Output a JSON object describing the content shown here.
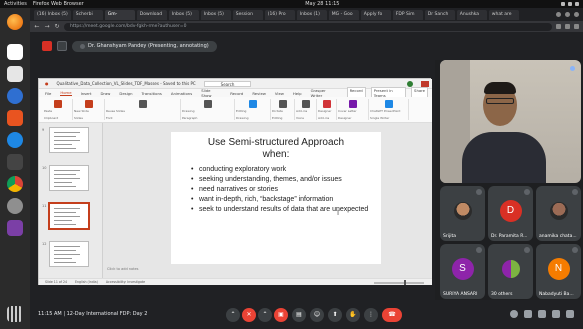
{
  "os": {
    "activities": "Activities",
    "browser_name": "Firefox Web Browser",
    "clock": "May 28 11:15"
  },
  "browser": {
    "tabs": [
      {
        "label": "(16) Inbox (5)"
      },
      {
        "label": "Scherbi"
      },
      {
        "label": "Gm-",
        "active": true
      },
      {
        "label": "Download"
      },
      {
        "label": "Inbox (5)"
      },
      {
        "label": "Inbox (5)"
      },
      {
        "label": "Session"
      },
      {
        "label": "(16) Pro"
      },
      {
        "label": "Inbox (1)"
      },
      {
        "label": "MG - Goo"
      },
      {
        "label": "Apply fo"
      },
      {
        "label": "FDP Sim"
      },
      {
        "label": "Dr Sanch"
      },
      {
        "label": "Anushka"
      },
      {
        "label": "what are"
      }
    ],
    "url": "https://meet.google.com/bdv-fgkh-rme?authuser=0"
  },
  "meet": {
    "presenting_label": "Dr. Ghanshyam Pandey (Presenting, annotating)",
    "meeting_time": "11:15 AM",
    "meeting_name": "12-Day International FDP: Day 2"
  },
  "powerpoint": {
    "file_title": "Qualitative_Data_Collection_VL_Slides_TDF_Masses - Saved to this PC",
    "search_placeholder": "Search",
    "menu": [
      "File",
      "Home",
      "Insert",
      "Draw",
      "Design",
      "Transitions",
      "Animations",
      "Slide Show",
      "Record",
      "Review",
      "View",
      "Help",
      "Grasper Writer"
    ],
    "active_menu": "Home",
    "menu_right": [
      "Record",
      "Present in Teams",
      "Share"
    ],
    "ribbon_groups": [
      "Clipboard",
      "Slides",
      "Font",
      "Paragraph",
      "Drawing",
      "Editing",
      "Voice",
      "Add-ins",
      "Designer",
      "Single Writer"
    ],
    "ribbon_labels": [
      "Paste",
      "New Slide",
      "Reuse Slides",
      "Drawing",
      "Editing",
      "Dictate",
      "Add-ins",
      "Designer",
      "Cover Letter",
      "ChatGPT PowerPoint"
    ],
    "notes_placeholder": "Click to add notes",
    "status": [
      "Slide 11 of 24",
      "English (India)",
      "Accessibility: Investigate"
    ],
    "thumbnails": [
      {
        "num": "9"
      },
      {
        "num": "10"
      },
      {
        "num": "11",
        "selected": true
      },
      {
        "num": "12"
      }
    ]
  },
  "slide": {
    "title_line1": "Use Semi-structured Approach",
    "title_line2": "when:",
    "bullets": [
      "conducting exploratory work",
      "seeking understanding, themes, and/or issues",
      "need narratives or stories",
      "want in-depth, rich, “backstage” information",
      "seek to understand results of data that are unexpected"
    ]
  },
  "participants": [
    {
      "name": "Srijita",
      "type": "photo",
      "color": "#c08a64"
    },
    {
      "name": "Dr. Paramita R...",
      "type": "initial",
      "initial": "D",
      "color": "#d93025"
    },
    {
      "name": "anamika chata...",
      "type": "photo",
      "color": "#9c6b55"
    },
    {
      "name": "SURIYA ANSARI",
      "type": "initial",
      "initial": "S",
      "color": "#8e24aa"
    },
    {
      "name": "30 others",
      "type": "others",
      "color": "#5f6368"
    },
    {
      "name": "Nabadyuti Ba...",
      "type": "initial",
      "initial": "N",
      "color": "#f57c00"
    }
  ],
  "colors": {
    "meet_bg": "#202124",
    "tile_bg": "#3c4043",
    "hangup": "#ea4335",
    "ppt_accent": "#c43e1c"
  }
}
